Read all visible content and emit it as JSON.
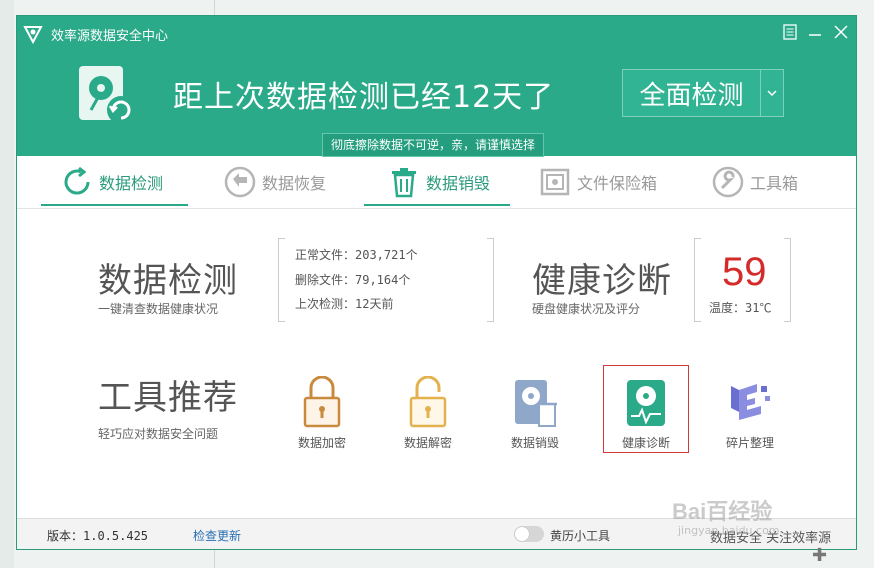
{
  "app": {
    "title": "效率源数据安全中心",
    "window_controls": [
      "menu-icon",
      "minimize-icon",
      "close-icon"
    ]
  },
  "banner": {
    "message": "距上次数据检测已经12天了",
    "scan_button": "全面检测",
    "tooltip": "彻底擦除数据不可逆，亲，请谨慎选择"
  },
  "tabs": [
    {
      "label": "数据检测",
      "icon": "refresh-icon",
      "active": true
    },
    {
      "label": "数据恢复",
      "icon": "back-arrow-icon",
      "active": false
    },
    {
      "label": "数据销毁",
      "icon": "trash-icon",
      "active": true
    },
    {
      "label": "文件保险箱",
      "icon": "safe-icon",
      "active": false
    },
    {
      "label": "工具箱",
      "icon": "wrench-icon",
      "active": false
    }
  ],
  "detect": {
    "title": "数据检测",
    "subtitle": "一键清查数据健康状况",
    "normal_files": "正常文件：203,721个",
    "deleted_files": "删除文件：79,164个",
    "last_check": "上次检测：12天前"
  },
  "health": {
    "title": "健康诊断",
    "subtitle": "硬盘健康状况及评分",
    "score": "59",
    "temperature": "温度：31℃"
  },
  "tools": {
    "title": "工具推荐",
    "subtitle": "轻巧应对数据安全问题",
    "items": [
      {
        "label": "数据加密",
        "icon": "lock-icon",
        "color": "#c98a3d"
      },
      {
        "label": "数据解密",
        "icon": "unlock-icon",
        "color": "#e3b24f"
      },
      {
        "label": "数据销毁",
        "icon": "disk-trash-icon",
        "color": "#8fa7c9"
      },
      {
        "label": "健康诊断",
        "icon": "disk-health-icon",
        "color": "#2aaa89",
        "selected": true
      },
      {
        "label": "碎片整理",
        "icon": "defrag-icon",
        "color": "#6b6fd1"
      }
    ]
  },
  "footer": {
    "version": "版本：1.0.5.425",
    "update": "检查更新",
    "calendar_tool": "黄历小工具",
    "brand": "数据安全 关注效率源"
  },
  "watermark": {
    "main": "Bai百经验",
    "sub": "jingyan.baidu.com"
  },
  "colors": {
    "brand": "#2aaa89",
    "danger": "#d42a2a",
    "highlight_border": "#d23b3b"
  }
}
